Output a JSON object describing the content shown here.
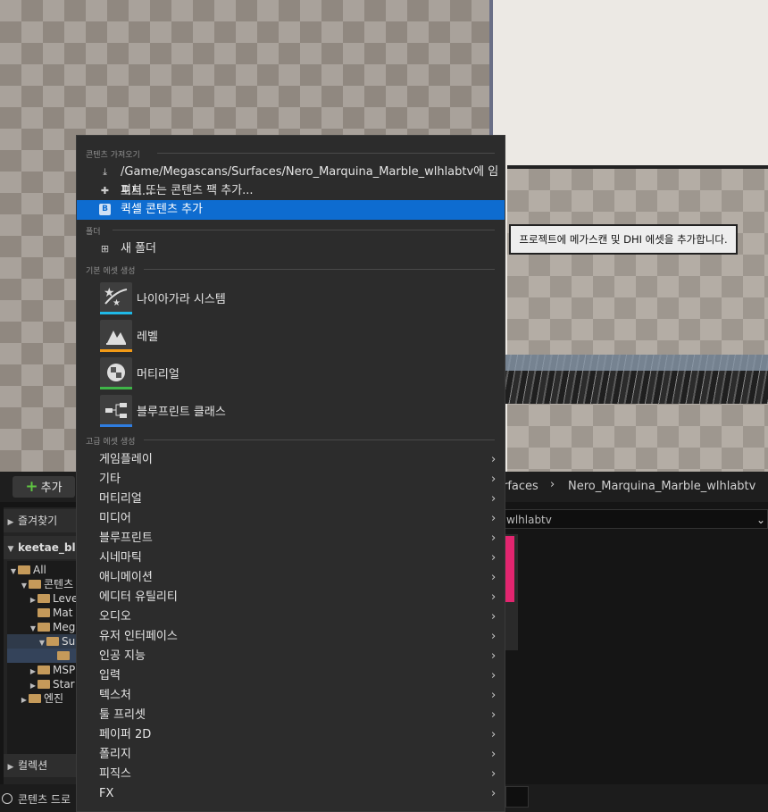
{
  "viewport": {},
  "tooltip": {
    "text": "프로젝트에 메가스캔 및 DHI 에셋을 추가합니다."
  },
  "menu": {
    "sections": {
      "import": "콘텐츠 가져오기",
      "folder": "폴더",
      "basic": "기본 에셋 생성",
      "advanced": "고급 에셋 생성"
    },
    "import_items": [
      {
        "label": "/Game/Megascans/Surfaces/Nero_Marquina_Marble_wlhlabtv에 임포트...",
        "icon": "import-icon"
      },
      {
        "label": "피처 또는 콘텐츠 팩 추가...",
        "icon": "content-pack-icon"
      },
      {
        "label": "퀵셀 콘텐츠 추가",
        "icon": "quixel-icon"
      }
    ],
    "folder_item": {
      "label": "새 폴더",
      "icon": "new-folder-icon"
    },
    "basic_items": [
      {
        "label": "나이아가라 시스템",
        "icon": "niagara-icon",
        "color": "#1fb8e6"
      },
      {
        "label": "레벨",
        "icon": "level-icon",
        "color": "#f29a16"
      },
      {
        "label": "머티리얼",
        "icon": "material-icon",
        "color": "#3fb548"
      },
      {
        "label": "블루프린트 클래스",
        "icon": "blueprint-icon",
        "color": "#2f7de0"
      }
    ],
    "advanced_items": [
      "게임플레이",
      "기타",
      "머티리얼",
      "미디어",
      "블루프린트",
      "시네마틱",
      "애니메이션",
      "에디터 유틸리티",
      "오디오",
      "유저 인터페이스",
      "인공 지능",
      "입력",
      "텍스처",
      "툴 프리셋",
      "페이퍼 2D",
      "폴리지",
      "피직스",
      "FX"
    ]
  },
  "content_browser": {
    "add_label": "추가",
    "breadcrumbs": [
      "rfaces",
      "Nero_Marquina_Marble_wlhlabtv"
    ],
    "path_value": "wlhlabtv",
    "favorites_label": "즐겨찾기",
    "project_label": "keetae_bl",
    "collections_label": "컬렉션",
    "tree": [
      "All",
      "콘텐츠",
      "Leve",
      "Mat",
      "Meg",
      "Su",
      "",
      "MSP",
      "Star",
      "엔진"
    ],
    "status_text": "콘텐츠 드로"
  },
  "colors": {
    "accent": "#0e6cd0",
    "add_plus": "#5fc542"
  }
}
